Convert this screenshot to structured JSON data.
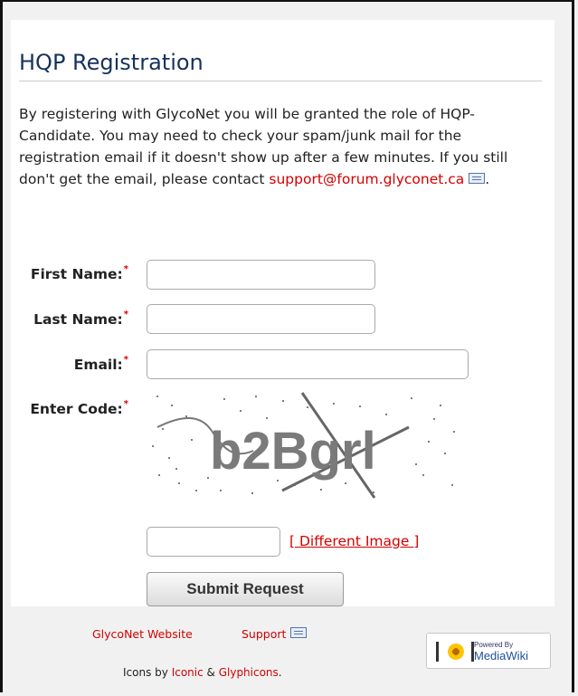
{
  "page": {
    "title": "HQP Registration",
    "intro_text": "By registering with GlycoNet you will be granted the role of HQP-Candidate. You may need to check your spam/junk mail for the registration email if it doesn't show up after a few minutes. If you still don't get the email, please contact ",
    "support_email": "support@forum.glyconet.ca",
    "intro_end": "."
  },
  "form": {
    "first_name_label": "First Name:",
    "last_name_label": "Last Name:",
    "email_label": "Email:",
    "code_label": "Enter Code:",
    "required_mark": "*",
    "first_name_value": "",
    "last_name_value": "",
    "email_value": "",
    "code_value": "",
    "captcha_text": "b2Bgrl",
    "different_image": "[ Different Image ]",
    "submit_label": "Submit Request"
  },
  "footer": {
    "website_link": "GlycoNet Website",
    "support_link": "Support",
    "credit_prefix": "Icons by ",
    "iconic": "Iconic",
    "amp": " & ",
    "glyphicons": "Glyphicons",
    "credit_suffix": ".",
    "powered_small": "Powered By",
    "powered_big": "MediaWiki"
  },
  "colors": {
    "accent": "#d40000",
    "title": "#16325c",
    "background": "#f1f1f1"
  }
}
